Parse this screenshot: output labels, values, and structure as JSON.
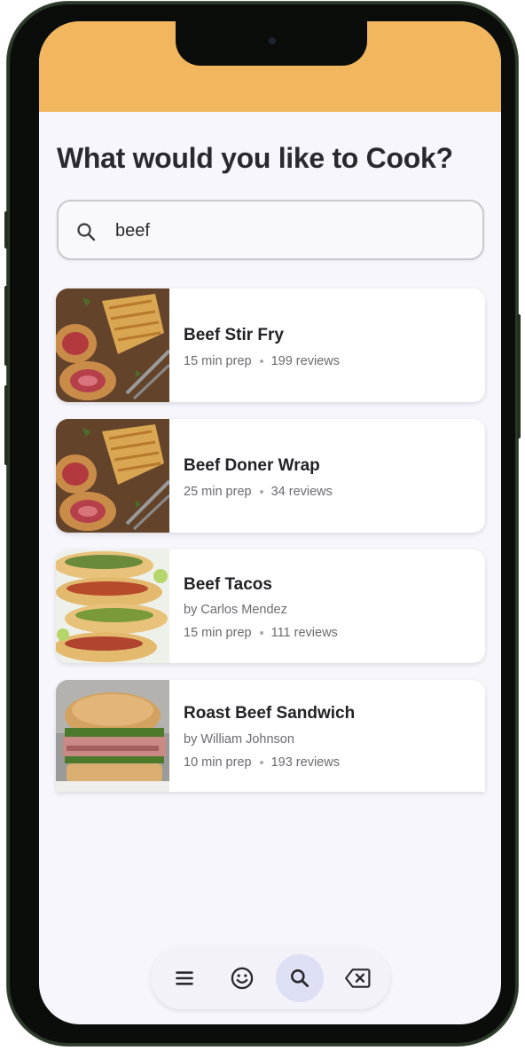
{
  "colors": {
    "status_bar": "#f2b65e",
    "screen_background": "#f7f6fc",
    "active_nav": "#dde0f5"
  },
  "page": {
    "title": "What would you like to Cook?"
  },
  "search": {
    "value": "beef",
    "icon": "search-icon"
  },
  "recipes": [
    {
      "name": "Beef Stir Fry",
      "author": "",
      "prep": "15 min prep",
      "reviews": "199 reviews",
      "image": "beef-wellington-photo"
    },
    {
      "name": "Beef Doner Wrap",
      "author": "",
      "prep": "25 min prep",
      "reviews": "34 reviews",
      "image": "beef-wellington-photo"
    },
    {
      "name": "Beef Tacos",
      "author": "by Carlos Mendez",
      "prep": "15 min prep",
      "reviews": "111 reviews",
      "image": "tacos-photo"
    },
    {
      "name": "Roast Beef Sandwich",
      "author": "by William Johnson",
      "prep": "10 min prep",
      "reviews": "193 reviews",
      "image": "sandwich-photo"
    }
  ],
  "bottom_nav": [
    {
      "icon": "menu-icon",
      "active": false
    },
    {
      "icon": "smiley-icon",
      "active": false
    },
    {
      "icon": "search-icon",
      "active": true
    },
    {
      "icon": "backspace-icon",
      "active": false
    }
  ]
}
